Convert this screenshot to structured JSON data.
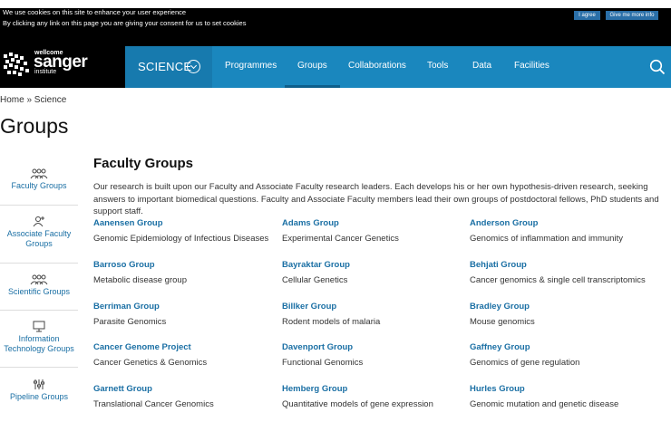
{
  "cookie": {
    "line1": "We use cookies on this site to enhance your user experience",
    "line2": "By clicking any link on this page you are giving your consent for us to set cookies",
    "agree_label": "I agree",
    "more_label": "Give me more info"
  },
  "logo": {
    "top": "wellcome",
    "main": "sanger",
    "bottom": "institute"
  },
  "nav": {
    "section": "SCIENCE",
    "items": [
      "Programmes",
      "Groups",
      "Collaborations",
      "Tools",
      "Data",
      "Facilities"
    ],
    "active": "Groups"
  },
  "breadcrumb": "Home » Science",
  "page_title": "Groups",
  "sidebar": {
    "items": [
      "Faculty Groups",
      "Associate Faculty Groups",
      "Scientific Groups",
      "Information Technology Groups",
      "Pipeline Groups"
    ]
  },
  "main": {
    "section_title": "Faculty Groups",
    "intro": "Our research is built upon our Faculty and Associate Faculty research leaders. Each develops his or her own hypothesis-driven research, seeking answers to important biomedical questions. Faculty and Associate Faculty members lead their own groups of postdoctoral fellows, PhD students and support staff.",
    "groups": [
      {
        "name": "Aanensen Group",
        "desc": "Genomic Epidemiology of Infectious Diseases"
      },
      {
        "name": "Adams Group",
        "desc": "Experimental Cancer Genetics"
      },
      {
        "name": "Anderson Group",
        "desc": "Genomics of inflammation and immunity"
      },
      {
        "name": "Barroso Group",
        "desc": "Metabolic disease group"
      },
      {
        "name": "Bayraktar Group",
        "desc": "Cellular Genetics"
      },
      {
        "name": "Behjati Group",
        "desc": "Cancer genomics & single cell transcriptomics"
      },
      {
        "name": "Berriman Group",
        "desc": "Parasite Genomics"
      },
      {
        "name": "Billker Group",
        "desc": "Rodent models of malaria"
      },
      {
        "name": "Bradley Group",
        "desc": "Mouse genomics"
      },
      {
        "name": "Cancer Genome Project",
        "desc": "Cancer Genetics & Genomics"
      },
      {
        "name": "Davenport Group",
        "desc": "Functional Genomics"
      },
      {
        "name": "Gaffney Group",
        "desc": "Genomics of gene regulation"
      },
      {
        "name": "Garnett Group",
        "desc": "Translational Cancer Genomics"
      },
      {
        "name": "Hemberg Group",
        "desc": "Quantitative models of gene expression"
      },
      {
        "name": "Hurles Group",
        "desc": "Genomic mutation and genetic disease"
      }
    ]
  },
  "colors": {
    "nav_bg": "#1a87be",
    "link": "#1a6fa4",
    "header_bg": "#000000"
  }
}
